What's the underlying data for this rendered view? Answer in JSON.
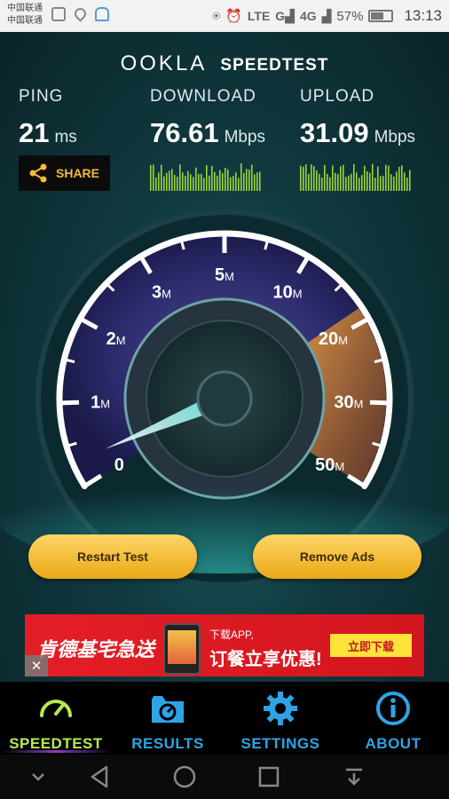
{
  "status_bar": {
    "carrier_1": "中国联通",
    "carrier_2": "中国联通",
    "network_1": "LTE",
    "network_2": "4G",
    "battery": "57%",
    "time": "13:13"
  },
  "header": {
    "logo_text": "OOKLA",
    "product": "SPEEDTEST"
  },
  "metrics": {
    "ping": {
      "label": "PING",
      "value": "21",
      "unit": "ms"
    },
    "download": {
      "label": "DOWNLOAD",
      "value": "76.61",
      "unit": "Mbps"
    },
    "upload": {
      "label": "UPLOAD",
      "value": "31.09",
      "unit": "Mbps"
    }
  },
  "share": {
    "label": "SHARE",
    "icon": "share-icon"
  },
  "gauge": {
    "ticks": [
      "0",
      "1",
      "2",
      "3",
      "5",
      "10",
      "20",
      "30",
      "50"
    ],
    "tick_unit": "M",
    "needle_value": 0.3
  },
  "buttons": {
    "restart": "Restart Test",
    "remove_ads": "Remove Ads"
  },
  "ad": {
    "brand": "肯德基宅急送",
    "line1": "下载APP,",
    "line2": "订餐立享优惠!",
    "cta": "立即下载",
    "close": "✕"
  },
  "tabs": [
    {
      "label": "SPEEDTEST",
      "icon": "speedometer-icon",
      "active": true
    },
    {
      "label": "RESULTS",
      "icon": "folder-icon",
      "active": false
    },
    {
      "label": "SETTINGS",
      "icon": "gear-icon",
      "active": false
    },
    {
      "label": "ABOUT",
      "icon": "info-icon",
      "active": false
    }
  ],
  "colors": {
    "accent_gold": "#f5b93a",
    "tab_blue": "#2fa3e6",
    "tab_active": "#b6e94e",
    "graph_green": "#9dd23a"
  }
}
